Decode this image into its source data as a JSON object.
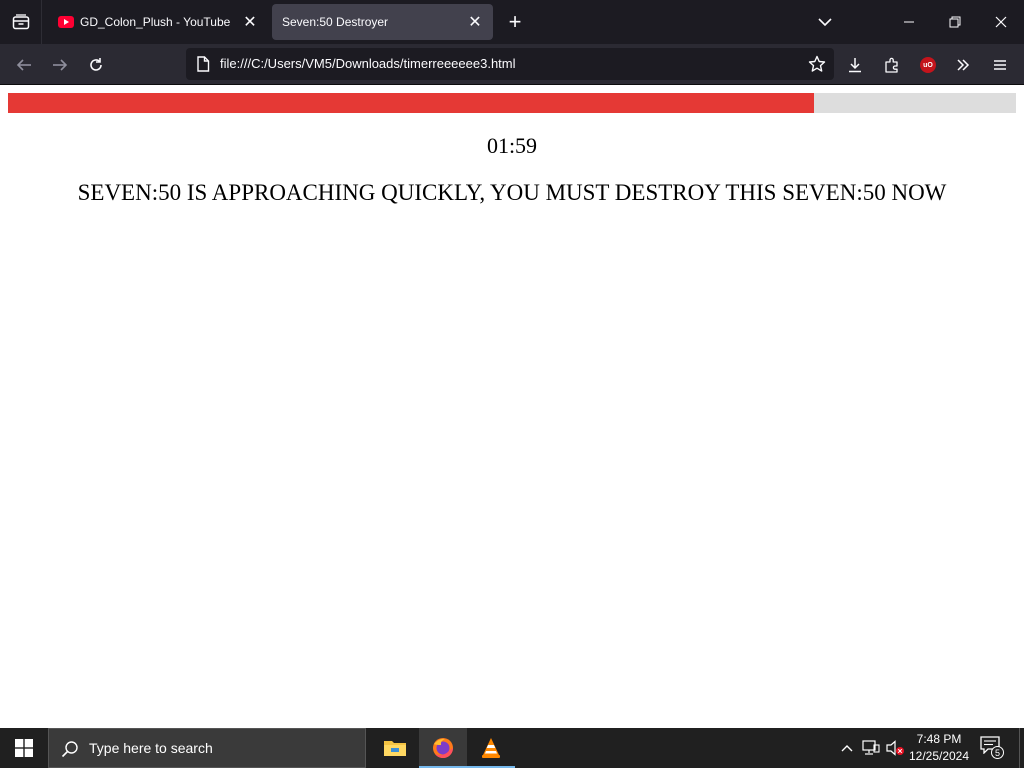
{
  "browser": {
    "tabs": [
      {
        "title": "GD_Colon_Plush - YouTube",
        "active": false
      },
      {
        "title": "Seven:50 Destroyer",
        "active": true
      }
    ],
    "url": "file:///C:/Users/VM5/Downloads/timerreeeeee3.html",
    "icons": {
      "tab_list": "tab-list-icon",
      "new_tab": "plus-icon",
      "list_all_tabs": "chevron-down-icon",
      "back": "arrow-left-icon",
      "forward": "arrow-right-icon",
      "reload": "reload-icon",
      "bookmark": "star-icon",
      "downloads": "download-icon",
      "extensions": "puzzle-icon",
      "ublock": "ublock-origin-icon",
      "overflow": "double-chevron-icon",
      "menu": "hamburger-icon"
    },
    "new_tab_symbol": "+",
    "close_symbol": "✕",
    "ublock_label": "uO"
  },
  "page": {
    "progress_fraction": 0.8,
    "progress_color": "#e53935",
    "progress_track_color": "#dddddd",
    "timer": "01:59",
    "message": "SEVEN:50 IS APPROACHING QUICKLY, YOU MUST DESTROY THIS SEVEN:50 NOW"
  },
  "taskbar": {
    "search_placeholder": "Type here to search",
    "apps": [
      "file-explorer-icon",
      "firefox-icon",
      "vlc-icon"
    ],
    "time": "7:48 PM",
    "date": "12/25/2024",
    "notification_count": "5"
  }
}
